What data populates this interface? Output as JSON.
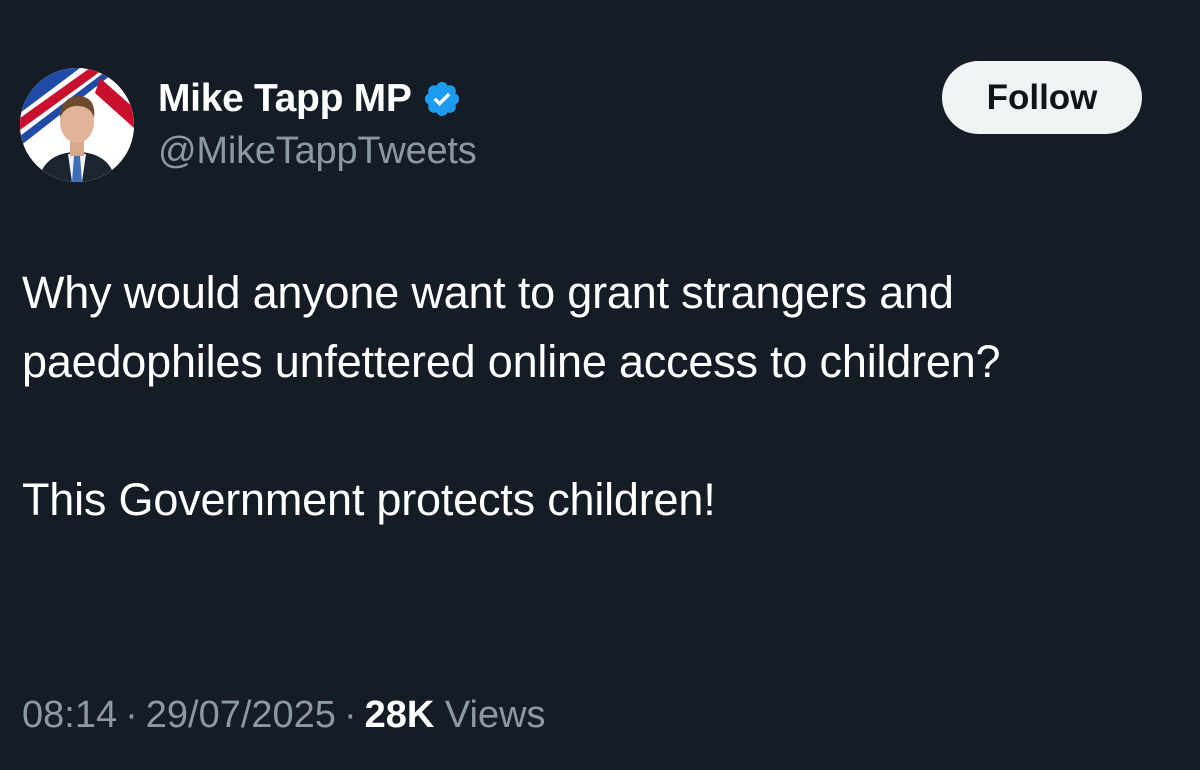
{
  "author": {
    "display_name": "Mike Tapp MP",
    "handle": "@MikeTappTweets",
    "verified": true,
    "verified_icon": "verified-badge-icon",
    "avatar_icon": "profile-photo"
  },
  "follow_button": {
    "label": "Follow"
  },
  "tweet": {
    "paragraphs": [
      "Why would anyone want to grant strangers and paedophiles unfettered online access to children?",
      "This Government protects children!"
    ]
  },
  "meta": {
    "time": "08:14",
    "date": "29/07/2025",
    "separator": "·",
    "views_count": "28K",
    "views_label": "Views"
  },
  "colors": {
    "background": "#151c26",
    "text_primary": "#ffffff",
    "text_secondary": "#8b98a5",
    "verified_blue": "#1d9bf0",
    "button_bg": "#eff3f4"
  }
}
